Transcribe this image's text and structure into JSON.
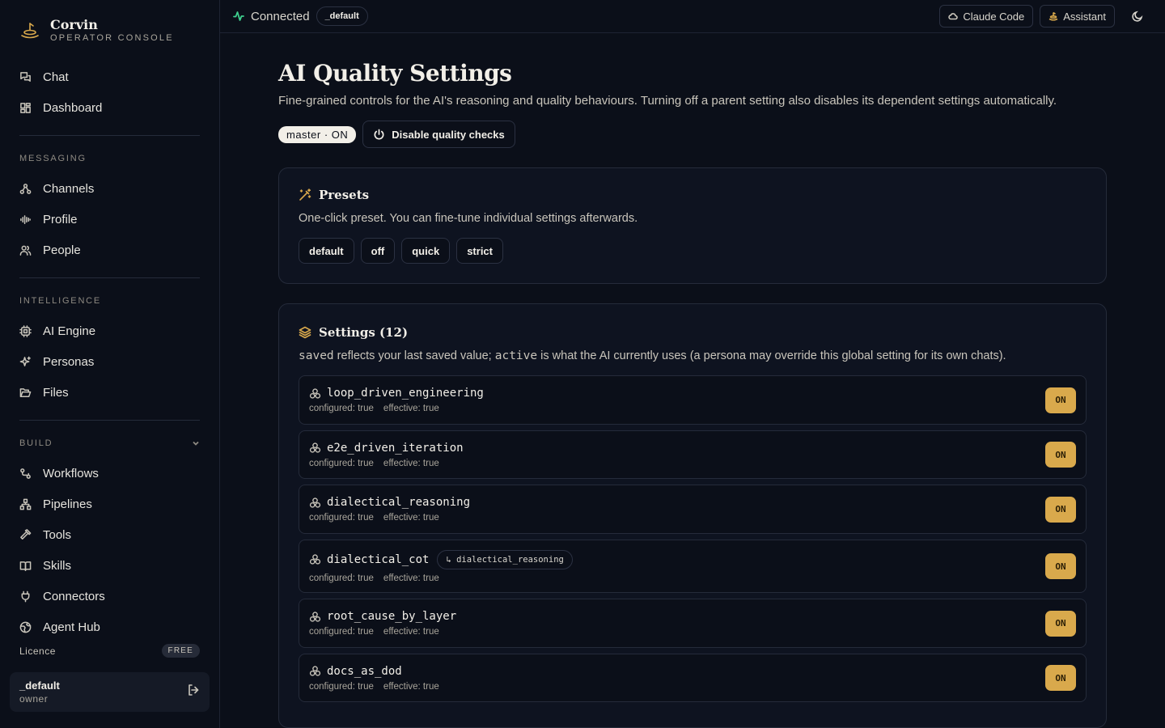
{
  "brand": {
    "name": "Corvin",
    "subtitle": "OPERATOR CONSOLE"
  },
  "nav_top": [
    {
      "label": "Chat",
      "icon": "chat-icon"
    },
    {
      "label": "Dashboard",
      "icon": "dashboard-icon"
    }
  ],
  "sections": {
    "messaging": {
      "title": "MESSAGING",
      "items": [
        {
          "label": "Channels",
          "icon": "channels-icon"
        },
        {
          "label": "Profile",
          "icon": "waveform-icon"
        },
        {
          "label": "People",
          "icon": "people-icon"
        }
      ]
    },
    "intelligence": {
      "title": "INTELLIGENCE",
      "items": [
        {
          "label": "AI Engine",
          "icon": "cpu-icon"
        },
        {
          "label": "Personas",
          "icon": "sparkles-icon"
        },
        {
          "label": "Files",
          "icon": "folder-icon"
        }
      ]
    },
    "build": {
      "title": "BUILD",
      "items": [
        {
          "label": "Workflows",
          "icon": "workflow-icon"
        },
        {
          "label": "Pipelines",
          "icon": "pipeline-icon"
        },
        {
          "label": "Tools",
          "icon": "hammer-icon"
        },
        {
          "label": "Skills",
          "icon": "book-icon"
        },
        {
          "label": "Connectors",
          "icon": "plug-icon"
        },
        {
          "label": "Agent Hub",
          "icon": "globe-icon"
        }
      ]
    }
  },
  "licence": {
    "label": "Licence",
    "badge": "FREE"
  },
  "user": {
    "name": "_default",
    "role": "owner"
  },
  "topbar": {
    "status": "Connected",
    "tenant": "_default",
    "claude_code": "Claude Code",
    "assistant": "Assistant"
  },
  "page": {
    "title": "AI Quality Settings",
    "description": "Fine-grained controls for the AI's reasoning and quality behaviours. Turning off a parent setting also disables its dependent settings automatically.",
    "master": "master · ON",
    "disable_label": "Disable quality checks"
  },
  "presets": {
    "title": "Presets",
    "description": "One-click preset. You can fine-tune individual settings afterwards.",
    "items": [
      "default",
      "off",
      "quick",
      "strict"
    ]
  },
  "settings": {
    "title": "Settings (12)",
    "desc": {
      "saved": "saved",
      "part1": " reflects your last saved value; ",
      "active": "active",
      "part2": " is what the AI currently uses (a persona may override this global setting for its own chats)."
    },
    "rows": [
      {
        "name": "loop_driven_engineering",
        "configured": "configured: true",
        "effective": "effective: true",
        "state": "ON",
        "dep": ""
      },
      {
        "name": "e2e_driven_iteration",
        "configured": "configured: true",
        "effective": "effective: true",
        "state": "ON",
        "dep": ""
      },
      {
        "name": "dialectical_reasoning",
        "configured": "configured: true",
        "effective": "effective: true",
        "state": "ON",
        "dep": ""
      },
      {
        "name": "dialectical_cot",
        "configured": "configured: true",
        "effective": "effective: true",
        "state": "ON",
        "dep": "↳ dialectical_reasoning"
      },
      {
        "name": "root_cause_by_layer",
        "configured": "configured: true",
        "effective": "effective: true",
        "state": "ON",
        "dep": ""
      },
      {
        "name": "docs_as_dod",
        "configured": "configured: true",
        "effective": "effective: true",
        "state": "ON",
        "dep": ""
      }
    ]
  },
  "colors": {
    "accent": "#d9a94c",
    "connected": "#3ecf8e",
    "background": "#0b0f19"
  }
}
